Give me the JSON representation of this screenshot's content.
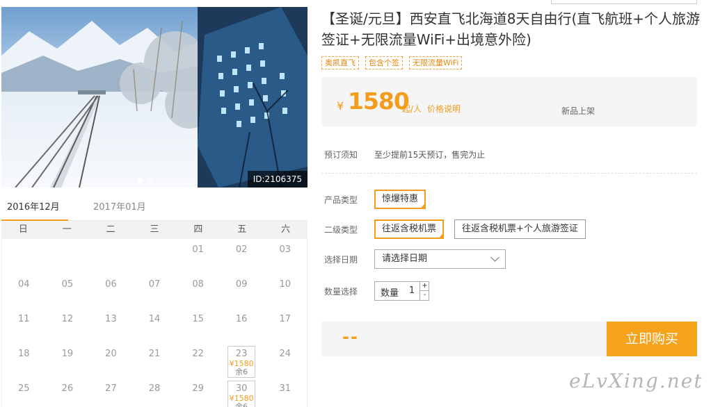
{
  "product": {
    "title": "【圣诞/元旦】西安直飞北海道8天自由行(直飞航班+个人旅游签证+无限流量WiFi+出境意外险)",
    "tags": [
      "奥凯直飞",
      "包含个签",
      "无限流量WiFi"
    ],
    "id_label": "ID:2106375"
  },
  "price": {
    "currency": "¥",
    "amount": "1580",
    "per": "起/人",
    "explain_link": "价格说明",
    "status": "新品上架"
  },
  "booking": {
    "notice_label": "预订须知",
    "notice_text": "至少提前15天预订，售完为止",
    "product_type_label": "产品类型",
    "product_type_selected": "惊爆特惠",
    "sub_type_label": "二级类型",
    "sub_type_options": [
      "往返含税机票",
      "往返含税机票+个人旅游签证"
    ],
    "sub_type_selected_index": 0,
    "date_label": "选择日期",
    "date_placeholder": "请选择日期",
    "qty_label": "数量选择",
    "qty_prefix": "数量",
    "qty_value": "1",
    "qty_plus": "+",
    "qty_minus": "-"
  },
  "total": {
    "value": "--"
  },
  "buy_button": {
    "label": "立即购买"
  },
  "watermark": "eLvXing.net",
  "calendar": {
    "tabs": [
      {
        "label": "2016年12月",
        "active": true
      },
      {
        "label": "2017年01月",
        "active": false
      }
    ],
    "weekdays": [
      "日",
      "一",
      "二",
      "三",
      "四",
      "五",
      "六"
    ],
    "weeks": [
      [
        {
          "d": ""
        },
        {
          "d": ""
        },
        {
          "d": ""
        },
        {
          "d": ""
        },
        {
          "d": "01"
        },
        {
          "d": "02"
        },
        {
          "d": "03"
        }
      ],
      [
        {
          "d": "04"
        },
        {
          "d": "05"
        },
        {
          "d": "06"
        },
        {
          "d": "07"
        },
        {
          "d": "08"
        },
        {
          "d": "09"
        },
        {
          "d": "10"
        }
      ],
      [
        {
          "d": "11"
        },
        {
          "d": "12"
        },
        {
          "d": "13"
        },
        {
          "d": "14"
        },
        {
          "d": "15"
        },
        {
          "d": "16"
        },
        {
          "d": "17"
        }
      ],
      [
        {
          "d": "18"
        },
        {
          "d": "19"
        },
        {
          "d": "20"
        },
        {
          "d": "21"
        },
        {
          "d": "22"
        },
        {
          "d": "23",
          "price": "¥1580",
          "rest": "余6"
        },
        {
          "d": "24"
        }
      ],
      [
        {
          "d": "25"
        },
        {
          "d": "26"
        },
        {
          "d": "27"
        },
        {
          "d": "28"
        },
        {
          "d": "29"
        },
        {
          "d": "30",
          "price": "¥1580",
          "rest": "余6"
        },
        {
          "d": "31"
        }
      ]
    ]
  },
  "colors": {
    "accent": "#f49c1b",
    "panel": "#f5f5f5"
  }
}
